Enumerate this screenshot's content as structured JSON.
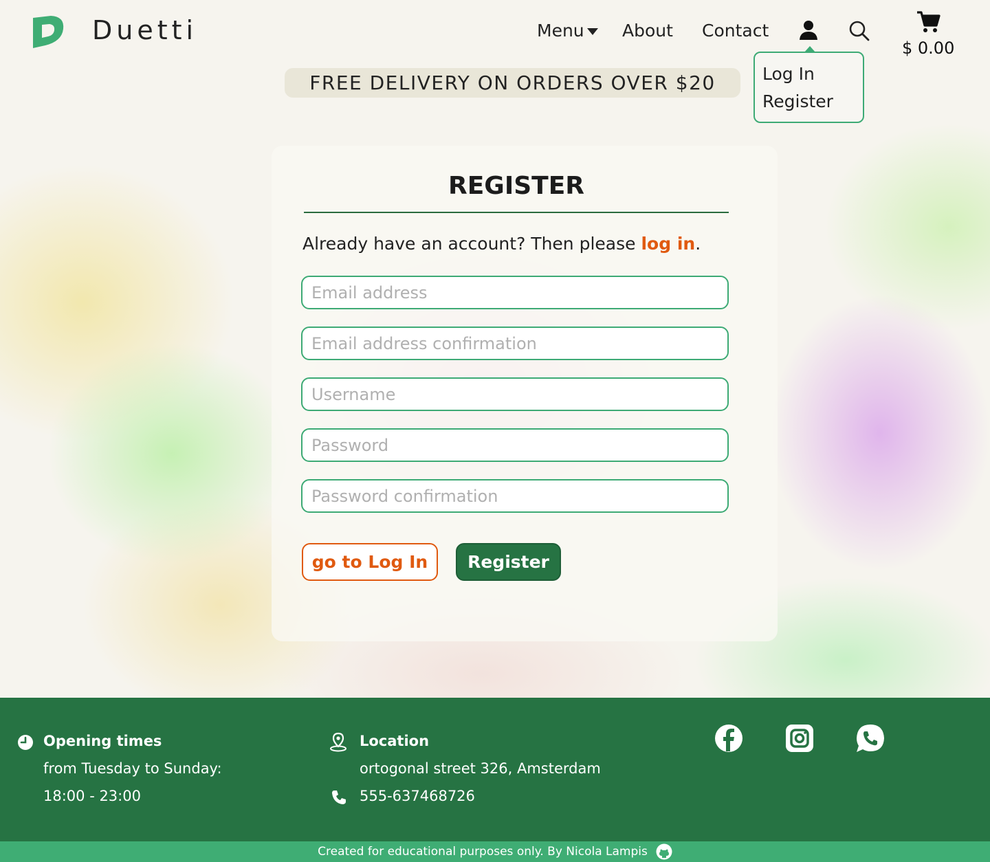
{
  "header": {
    "brand": "Duetti",
    "nav": {
      "menu": "Menu",
      "about": "About",
      "contact": "Contact"
    },
    "cart_total": "$ 0.00"
  },
  "user_dropdown": {
    "login": "Log In",
    "register": "Register"
  },
  "promo": "FREE DELIVERY ON ORDERS OVER $20",
  "register_form": {
    "title": "REGISTER",
    "already_text": "Already have an account? Then please ",
    "login_link": "log in",
    "period": ".",
    "fields": {
      "email": "Email address",
      "email_confirm": "Email address confirmation",
      "username": "Username",
      "password": "Password",
      "password_confirm": "Password confirmation"
    },
    "go_login_button": "go to Log In",
    "register_button": "Register"
  },
  "footer": {
    "opening_title": "Opening times",
    "opening_days": "from Tuesday to Sunday:",
    "opening_hours": "18:00 - 23:00",
    "location_title": "Location",
    "address": "ortogonal street 326, Amsterdam",
    "phone": "555-637468726",
    "social": [
      "facebook-icon",
      "instagram-icon",
      "whatsapp-icon"
    ],
    "credit": "Created for educational purposes only.  By Nicola Lampis"
  },
  "colors": {
    "brand_green": "#267343",
    "accent_green": "#3daa75",
    "accent_orange": "#e05a10"
  }
}
